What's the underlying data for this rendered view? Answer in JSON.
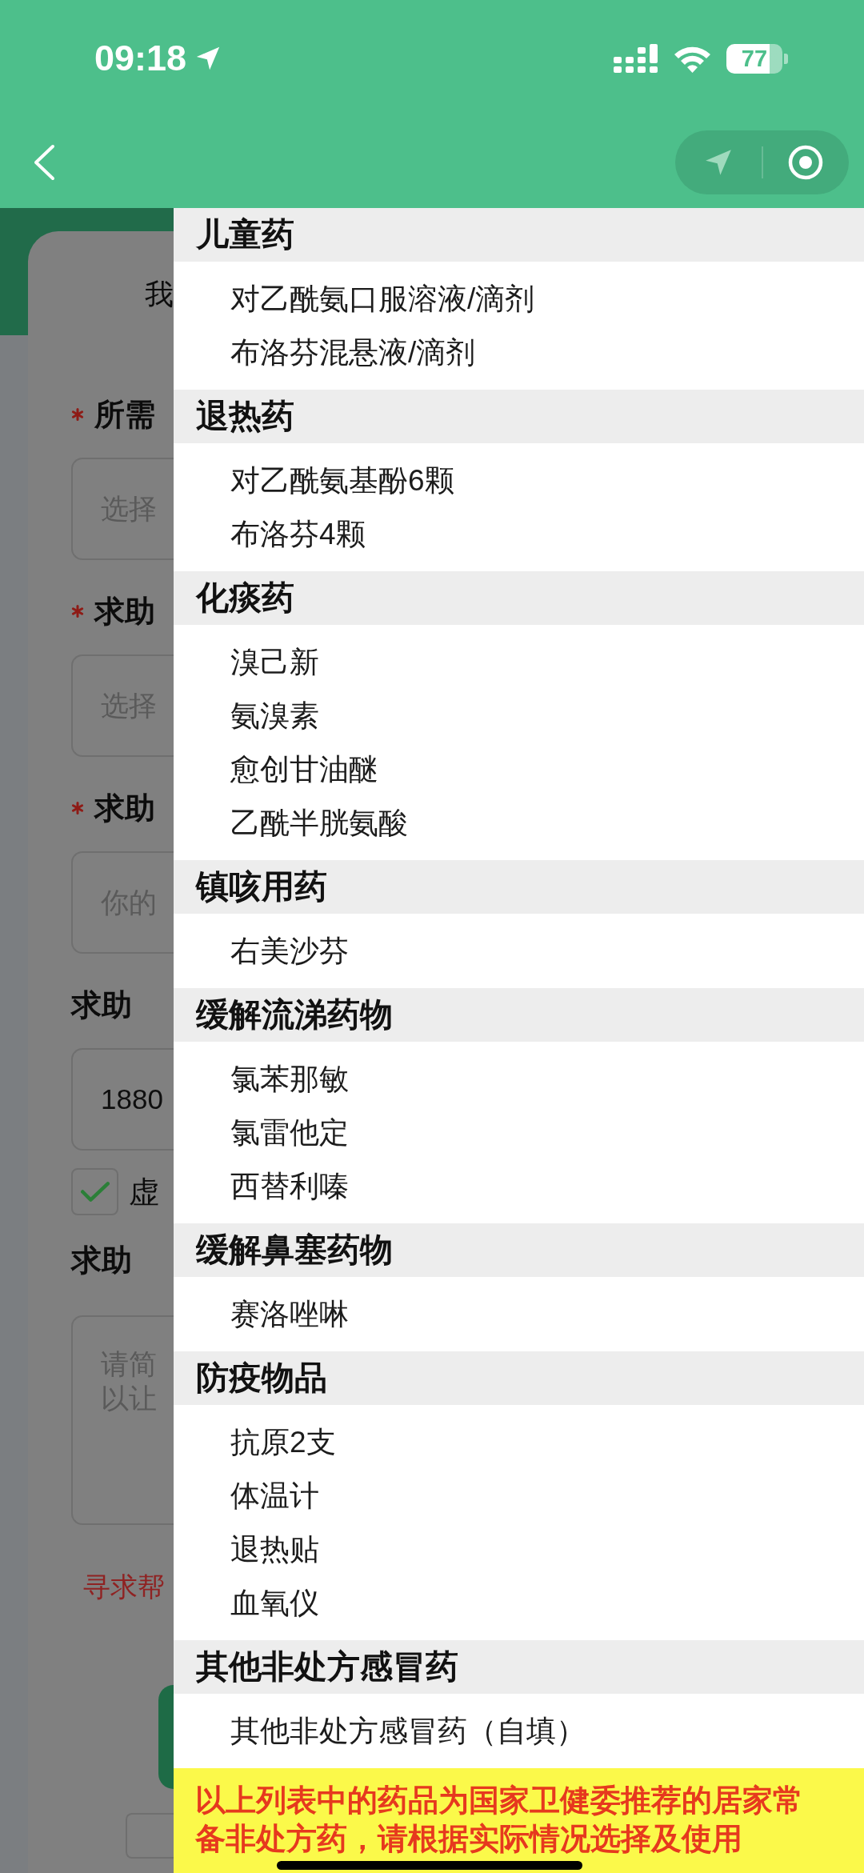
{
  "status_bar": {
    "time": "09:18",
    "battery": "77"
  },
  "form": {
    "title": "我",
    "fields": [
      {
        "kind": "input",
        "label": "所需",
        "required": true,
        "placeholder": "选择"
      },
      {
        "kind": "input",
        "label": "求助",
        "required": true,
        "placeholder": "选择"
      },
      {
        "kind": "input",
        "label": "求助",
        "required": true,
        "placeholder": "你的"
      },
      {
        "kind": "input",
        "label": "求助",
        "required": false,
        "value": "1880"
      },
      {
        "kind": "checkbox",
        "label": "虚",
        "checked": true
      },
      {
        "kind": "textarea",
        "label": "求助",
        "required": false,
        "placeholder": "请简以让"
      }
    ],
    "note": "寻求帮",
    "agreement": {
      "checked": false
    }
  },
  "drawer": {
    "categories": [
      {
        "title": "儿童药",
        "items": [
          "对乙酰氨口服溶液/滴剂",
          "布洛芬混悬液/滴剂"
        ]
      },
      {
        "title": "退热药",
        "items": [
          "对乙酰氨基酚6颗",
          "布洛芬4颗"
        ]
      },
      {
        "title": "化痰药",
        "items": [
          "溴己新",
          "氨溴素",
          "愈创甘油醚",
          "乙酰半胱氨酸"
        ]
      },
      {
        "title": "镇咳用药",
        "items": [
          "右美沙芬"
        ]
      },
      {
        "title": "缓解流涕药物",
        "items": [
          "氯苯那敏",
          "氯雷他定",
          "西替利嗪"
        ]
      },
      {
        "title": "缓解鼻塞药物",
        "items": [
          "赛洛唑啉"
        ]
      },
      {
        "title": "防疫物品",
        "items": [
          "抗原2支",
          "体温计",
          "退热贴",
          "血氧仪"
        ]
      },
      {
        "title": "其他非处方感冒药",
        "items": [
          "其他非处方感冒药（自填）"
        ]
      }
    ],
    "notice": "以上列表中的药品为国家卫健委推荐的居家常备非处方药，请根据实际情况选择及使用"
  }
}
